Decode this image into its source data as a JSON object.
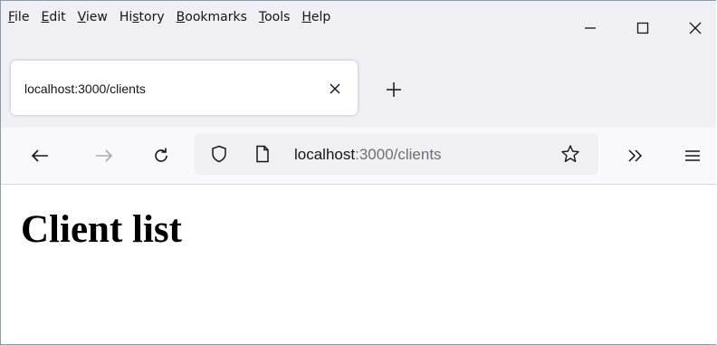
{
  "menu": {
    "items": [
      {
        "label": "File",
        "access": "F",
        "rest": "ile"
      },
      {
        "label": "Edit",
        "access": "E",
        "rest": "dit"
      },
      {
        "label": "View",
        "access": "V",
        "rest": "iew"
      },
      {
        "label": "History",
        "pre": "Hi",
        "access": "s",
        "rest": "tory"
      },
      {
        "label": "Bookmarks",
        "access": "B",
        "rest": "ookmarks"
      },
      {
        "label": "Tools",
        "access": "T",
        "rest": "ools"
      },
      {
        "label": "Help",
        "access": "H",
        "rest": "elp"
      }
    ]
  },
  "window_controls": {
    "minimize_icon": "minimize-icon",
    "maximize_icon": "maximize-icon",
    "close_icon": "close-icon"
  },
  "tab": {
    "title": "localhost:3000/clients",
    "close_icon": "close-icon"
  },
  "new_tab_icon": "plus-icon",
  "nav": {
    "back_icon": "arrow-left-icon",
    "forward_icon": "arrow-right-icon",
    "reload_icon": "reload-icon",
    "shield_icon": "shield-icon",
    "page_icon": "page-icon",
    "bookmark_icon": "star-icon",
    "overflow_icon": "chevrons-right-icon",
    "menu_icon": "hamburger-icon"
  },
  "url": {
    "host": "localhost",
    "path": ":3000/clients"
  },
  "page": {
    "heading": "Client list"
  },
  "colors": {
    "chrome_bg": "#f0f0f4",
    "toolbar_bg": "#f9f9fb",
    "text": "#15141a",
    "muted_text": "#6f6e76"
  }
}
